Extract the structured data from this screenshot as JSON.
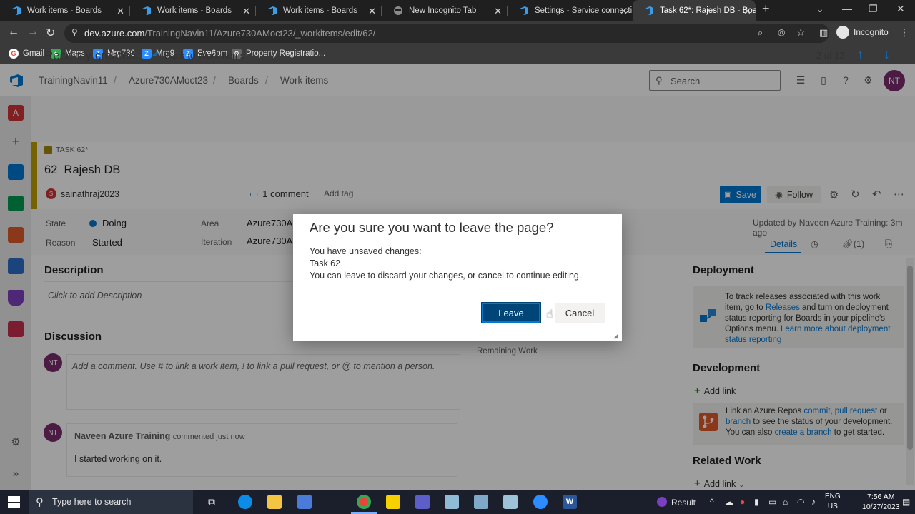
{
  "browser": {
    "tabs": [
      {
        "title": "Work items - Boards"
      },
      {
        "title": "Work items - Boards"
      },
      {
        "title": "Work items - Boards"
      },
      {
        "title": "New Incognito Tab"
      },
      {
        "title": "Settings - Service connecti"
      },
      {
        "title": "Task 62*: Rajesh DB - Boar",
        "active": true
      }
    ],
    "url_domain": "dev.azure.com",
    "url_path": "/TrainingNavin11/Azure730AMoct23/_workitems/edit/62/",
    "profile": "Incognito",
    "bookmarks": [
      "Gmail",
      "Maps",
      "Mrg730",
      "Mrg9",
      "Eve6pm",
      "Property Registratio..."
    ]
  },
  "topbar": {
    "breadcrumb": [
      "TrainingNavin11",
      "Azure730AMoct23",
      "Boards",
      "Work items"
    ],
    "search_placeholder": "Search",
    "avatar_initials": "NT"
  },
  "header": {
    "title": "Recently created",
    "back_label": "Back to Work Items",
    "pager": "2 of 12"
  },
  "workitem": {
    "type_badge": "TASK 62*",
    "id": "62",
    "title": "Rajesh DB",
    "assignee_initial": "S",
    "assignee": "sainathraj2023",
    "comments": "1 comment",
    "add_tag": "Add tag",
    "save": "Save",
    "follow": "Follow",
    "fields": {
      "state_label": "State",
      "state_value": "Doing",
      "reason_label": "Reason",
      "reason_value": "Started",
      "area_label": "Area",
      "area_value": "Azure730AM",
      "iteration_label": "Iteration",
      "iteration_value": "Azure730AM"
    },
    "updated": "Updated by Naveen Azure Training: 3m ago",
    "right_tabs": {
      "details": "Details",
      "links": "(1)"
    },
    "description_header": "Description",
    "description_placeholder": "Click to add Description",
    "discussion_header": "Discussion",
    "comment_placeholder": "Add a comment. Use # to link a work item, ! to link a pull request, or @ to mention a person.",
    "comment": {
      "author_initials": "NT",
      "author": "Naveen Azure Training",
      "meta": "commented just now",
      "text": "I started working on it."
    },
    "remaining_work_label": "Remaining Work"
  },
  "right_panel": {
    "deployment_header": "Deployment",
    "deployment_text_a": "To track releases associated with this work item, go to ",
    "deployment_link_a": "Releases",
    "deployment_text_b": " and turn on deployment status reporting for Boards in your pipeline's Options menu. ",
    "deployment_link_b": "Learn more about deployment status reporting",
    "development_header": "Development",
    "add_link": "Add link",
    "dev_text_a": "Link an Azure Repos ",
    "dev_link_commit": "commit",
    "dev_sep": ", ",
    "dev_link_pr": "pull request",
    "dev_text_b": " or ",
    "dev_link_branch": "branch",
    "dev_text_c": " to see the status of your development. You can also ",
    "dev_link_create": "create a branch",
    "dev_text_d": " to get started.",
    "related_header": "Related Work",
    "related_add_link": "Add link"
  },
  "dialog": {
    "title": "Are you sure you want to leave the page?",
    "line1": "You have unsaved changes:",
    "line2": "Task 62",
    "line3": "You can leave to discard your changes, or cancel to continue editing.",
    "leave": "Leave",
    "cancel": "Cancel"
  },
  "taskbar": {
    "search_placeholder": "Type here to search",
    "result_label": "Result",
    "lang_top": "ENG",
    "lang_bottom": "US",
    "time": "7:56 AM",
    "date": "10/27/2023"
  },
  "colors": {
    "accent": "#0078d4",
    "gold_bar": "#bfa100",
    "avatar": "#7b2c6f",
    "dialog_primary": "#004578"
  }
}
